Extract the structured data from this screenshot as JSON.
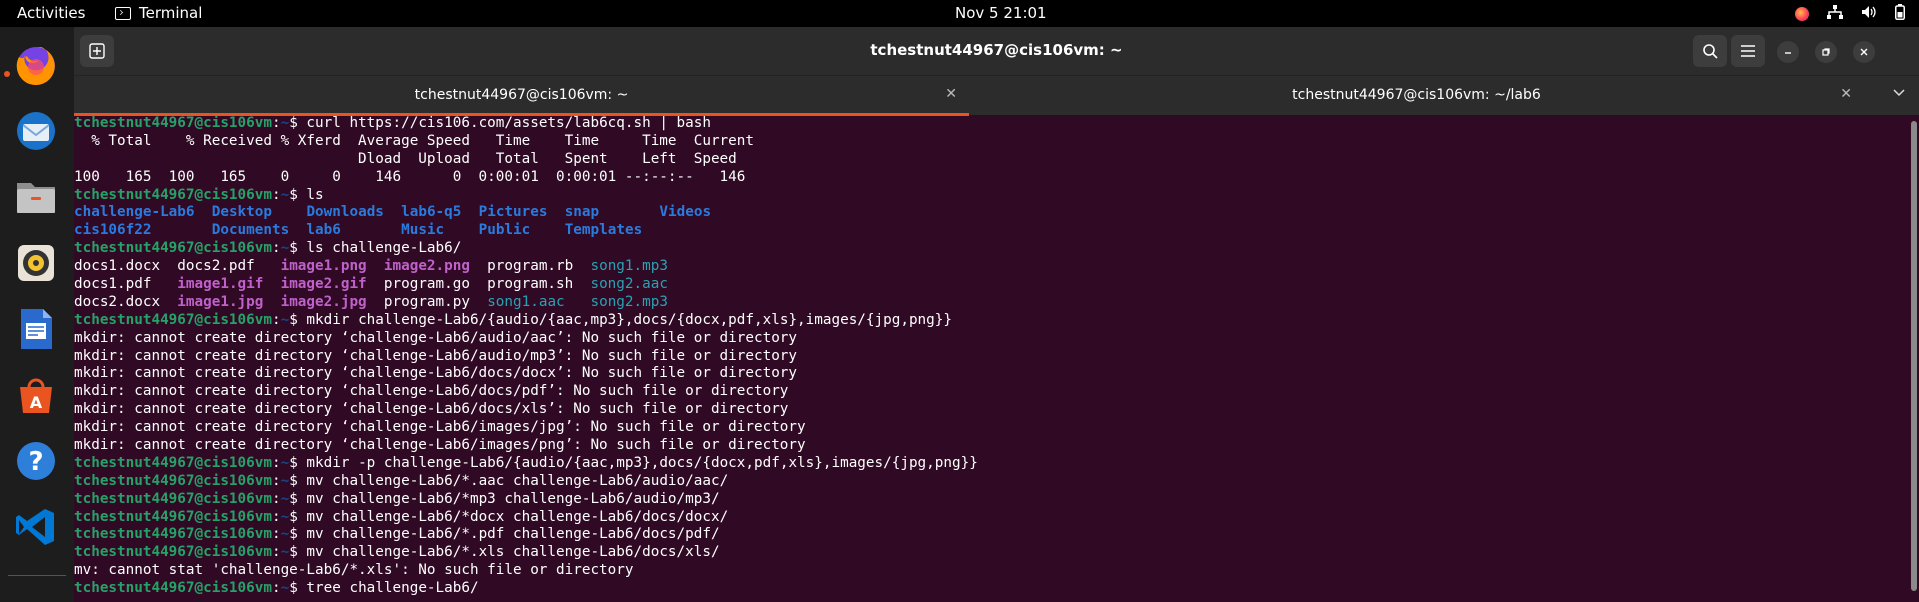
{
  "topbar": {
    "activities": "Activities",
    "app_name": "Terminal",
    "clock": "Nov 5  21:01"
  },
  "dock": {
    "items": [
      "firefox-icon",
      "thunderbird-icon",
      "files-icon",
      "rhythmbox-icon",
      "libreoffice-writer-icon",
      "app-center-icon",
      "help-icon",
      "vscode-icon"
    ]
  },
  "window": {
    "title": "tchestnut44967@cis106vm: ~",
    "tabs": [
      {
        "label": "tchestnut44967@cis106vm: ~",
        "active": true
      },
      {
        "label": "tchestnut44967@cis106vm: ~/lab6",
        "active": false
      }
    ]
  },
  "prompt": {
    "user": "tchestnut44967@cis106vm",
    "sep": ":",
    "dir": "~",
    "sym": "$ "
  },
  "terminal": {
    "lines": [
      {
        "type": "cmd",
        "text": "curl https://cis106.com/assets/lab6cq.sh | bash"
      },
      {
        "type": "out",
        "text": "  % Total    % Received % Xferd  Average Speed   Time    Time     Time  Current"
      },
      {
        "type": "out",
        "text": "                                 Dload  Upload   Total   Spent    Left  Speed"
      },
      {
        "type": "out",
        "text": "100   165  100   165    0     0    146      0  0:00:01  0:00:01 --:--:--   146"
      },
      {
        "type": "cmd",
        "text": "ls"
      },
      {
        "type": "segs",
        "segs": [
          {
            "t": "challenge-Lab6",
            "c": "dirc"
          },
          {
            "t": "  ",
            "c": ""
          },
          {
            "t": "Desktop",
            "c": "dirc"
          },
          {
            "t": "    ",
            "c": ""
          },
          {
            "t": "Downloads",
            "c": "dirc"
          },
          {
            "t": "  ",
            "c": ""
          },
          {
            "t": "lab6-q5",
            "c": "dirc"
          },
          {
            "t": "  ",
            "c": ""
          },
          {
            "t": "Pictures",
            "c": "dirc"
          },
          {
            "t": "  ",
            "c": ""
          },
          {
            "t": "snap",
            "c": "dirc"
          },
          {
            "t": "       ",
            "c": ""
          },
          {
            "t": "Videos",
            "c": "dirc"
          }
        ]
      },
      {
        "type": "segs",
        "segs": [
          {
            "t": "cis106f22",
            "c": "dirc"
          },
          {
            "t": "       ",
            "c": ""
          },
          {
            "t": "Documents",
            "c": "dirc"
          },
          {
            "t": "  ",
            "c": ""
          },
          {
            "t": "lab6",
            "c": "dirc"
          },
          {
            "t": "       ",
            "c": ""
          },
          {
            "t": "Music",
            "c": "dirc"
          },
          {
            "t": "    ",
            "c": ""
          },
          {
            "t": "Public",
            "c": "dirc"
          },
          {
            "t": "    ",
            "c": ""
          },
          {
            "t": "Templates",
            "c": "dirc"
          }
        ]
      },
      {
        "type": "cmd",
        "text": "ls challenge-Lab6/"
      },
      {
        "type": "segs",
        "segs": [
          {
            "t": "docs1.docx  docs2.pdf   ",
            "c": ""
          },
          {
            "t": "image1.png",
            "c": "img"
          },
          {
            "t": "  ",
            "c": ""
          },
          {
            "t": "image2.png",
            "c": "img"
          },
          {
            "t": "  program.rb  ",
            "c": ""
          },
          {
            "t": "song1.mp3",
            "c": "aud"
          }
        ]
      },
      {
        "type": "segs",
        "segs": [
          {
            "t": "docs1.pdf   ",
            "c": ""
          },
          {
            "t": "image1.gif",
            "c": "img"
          },
          {
            "t": "  ",
            "c": ""
          },
          {
            "t": "image2.gif",
            "c": "img"
          },
          {
            "t": "  program.go  program.sh  ",
            "c": ""
          },
          {
            "t": "song2.aac",
            "c": "aud"
          }
        ]
      },
      {
        "type": "segs",
        "segs": [
          {
            "t": "docs2.docx  ",
            "c": ""
          },
          {
            "t": "image1.jpg",
            "c": "img"
          },
          {
            "t": "  ",
            "c": ""
          },
          {
            "t": "image2.jpg",
            "c": "img"
          },
          {
            "t": "  program.py  ",
            "c": ""
          },
          {
            "t": "song1.aac",
            "c": "aud"
          },
          {
            "t": "   ",
            "c": ""
          },
          {
            "t": "song2.mp3",
            "c": "aud"
          }
        ]
      },
      {
        "type": "cmd",
        "text": "mkdir challenge-Lab6/{audio/{aac,mp3},docs/{docx,pdf,xls},images/{jpg,png}}"
      },
      {
        "type": "out",
        "text": "mkdir: cannot create directory ‘challenge-Lab6/audio/aac’: No such file or directory"
      },
      {
        "type": "out",
        "text": "mkdir: cannot create directory ‘challenge-Lab6/audio/mp3’: No such file or directory"
      },
      {
        "type": "out",
        "text": "mkdir: cannot create directory ‘challenge-Lab6/docs/docx’: No such file or directory"
      },
      {
        "type": "out",
        "text": "mkdir: cannot create directory ‘challenge-Lab6/docs/pdf’: No such file or directory"
      },
      {
        "type": "out",
        "text": "mkdir: cannot create directory ‘challenge-Lab6/docs/xls’: No such file or directory"
      },
      {
        "type": "out",
        "text": "mkdir: cannot create directory ‘challenge-Lab6/images/jpg’: No such file or directory"
      },
      {
        "type": "out",
        "text": "mkdir: cannot create directory ‘challenge-Lab6/images/png’: No such file or directory"
      },
      {
        "type": "cmd",
        "text": "mkdir -p challenge-Lab6/{audio/{aac,mp3},docs/{docx,pdf,xls},images/{jpg,png}}"
      },
      {
        "type": "cmd",
        "text": "mv challenge-Lab6/*.aac challenge-Lab6/audio/aac/"
      },
      {
        "type": "cmd",
        "text": "mv challenge-Lab6/*mp3 challenge-Lab6/audio/mp3/"
      },
      {
        "type": "cmd",
        "text": "mv challenge-Lab6/*docx challenge-Lab6/docs/docx/"
      },
      {
        "type": "cmd",
        "text": "mv challenge-Lab6/*.pdf challenge-Lab6/docs/pdf/"
      },
      {
        "type": "cmd",
        "text": "mv challenge-Lab6/*.xls challenge-Lab6/docs/xls/"
      },
      {
        "type": "out",
        "text": "mv: cannot stat 'challenge-Lab6/*.xls': No such file or directory"
      },
      {
        "type": "cmd",
        "text": "tree challenge-Lab6/"
      }
    ]
  }
}
